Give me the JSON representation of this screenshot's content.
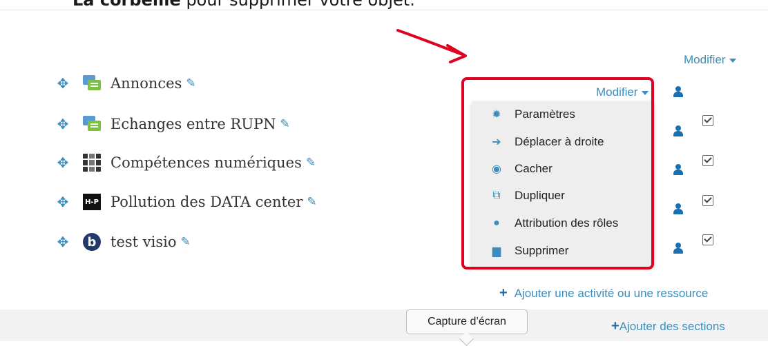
{
  "header": {
    "instruction_bold": "La corbeille",
    "instruction_rest": " pour supprimer votre objet."
  },
  "modifier_label": "Modifier",
  "activities": [
    {
      "name": "Annonces",
      "icon": "forum-icon"
    },
    {
      "name": "Echanges entre RUPN",
      "icon": "forum-icon"
    },
    {
      "name": "Compétences numériques",
      "icon": "competences-icon"
    },
    {
      "name": "Pollution des DATA center",
      "icon": "h5p-icon"
    },
    {
      "name": "test visio",
      "icon": "bigbluebutton-icon"
    }
  ],
  "h5p_icon_text": "H-P",
  "bbb_icon_text": "b",
  "edit_menu": {
    "trigger_label": "Modifier",
    "items": [
      {
        "label": "Paramètres",
        "icon": "gear-icon"
      },
      {
        "label": "Déplacer à droite",
        "icon": "arrow-right-icon"
      },
      {
        "label": "Cacher",
        "icon": "eye-icon"
      },
      {
        "label": "Dupliquer",
        "icon": "duplicate-icon"
      },
      {
        "label": "Attribution des rôles",
        "icon": "user-circle-icon"
      },
      {
        "label": "Supprimer",
        "icon": "trash-icon"
      }
    ]
  },
  "add_activity_label": "Ajouter une activité ou une ressource",
  "add_sections_label": "Ajouter des sections",
  "tooltip_text": "Capture d’écran",
  "colors": {
    "link": "#3c8dbc",
    "highlight": "#e00020",
    "menu_bg": "#eeeeee"
  }
}
